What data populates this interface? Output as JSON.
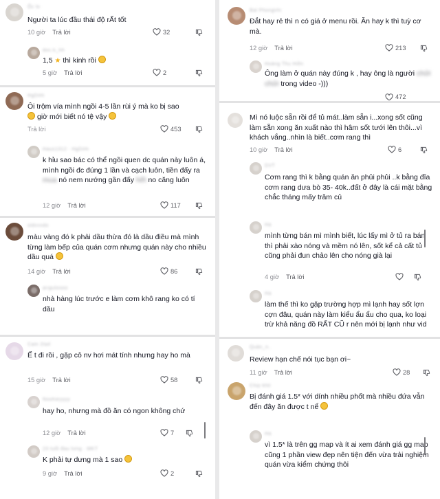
{
  "icons": {
    "like": "heart-outline-icon",
    "dislike": "thumbs-down-icon",
    "emoji": "emoji-face-icon"
  },
  "colors": {
    "text": "#161823",
    "meta": "#8a8b91",
    "divider": "#e9e9ea",
    "emoji": "#f5c33b"
  },
  "reply_label": "Trả lời",
  "left": [
    {
      "username": "Ốc lo",
      "text": "Người ta lúc đầu thái độ rẤt tốt",
      "time": "10 giờ",
      "likes": "32"
    },
    {
      "username": "doc.ti_hh",
      "text_pre": "1,5",
      "text_post": "thì kinh rồi",
      "time": "5 giờ",
      "likes": "2",
      "emoji": true
    },
    {
      "username": "HgDiHi",
      "text": "Ôi trộm vía mình ngồi 4-5 lần rùi ý mà ko bị sao",
      "text2": "giờ mới biết nó tệ vậy",
      "time": "Trả lời",
      "likes": "453"
    },
    {
      "username": "Haus1312 · HgDiHi",
      "text": "k hỉu sao bác có thể ngồi quen dc quán này luôn á, mình ngồi đc đúng 1 lần và cạch luôn, tiền đấy ra",
      "text_blur1": "mua",
      "text_mid": "nó nem nướng gần đấy",
      "text_blur2": "hết",
      "text_end": "no căng luôn",
      "time": "12 giờ",
      "likes": "117"
    },
    {
      "username": "oldvvvdo",
      "text": "màu vàng đó k phải dầu thừa đó là dầu điều mà mình từng làm bếp của quán cơm nhưng quán này cho nhiều dầu quá",
      "time": "14 giờ",
      "likes": "86"
    },
    {
      "username": "ariguloooo",
      "text": "nhà hàng lúc trước e làm cơm khô rang ko có tí dầu",
      "time": "",
      "likes": ""
    },
    {
      "username": "Cam 2ta4",
      "text": "Ế t đi rồi , gặp cô nv hơi mát tính nhưng hay ho mà",
      "time": "15 giờ",
      "likes": "58"
    },
    {
      "username": "Noohieyyyy",
      "text": "hay ho, nhưng mà đồ ăn có ngon không chứ",
      "time": "12 giờ",
      "likes": "7"
    },
    {
      "username": "23 tuổi đau lưng · MKT",
      "text": "K phải tự dưng mà 1 sao",
      "time": "9 giờ",
      "likes": "2"
    }
  ],
  "right": [
    {
      "username": "Bal Phongnhi",
      "text": "Đắt hay rẻ thì n có giá ở menu rồi. Ăn hay k thì tuỳ cơ mà.",
      "time": "12 giờ",
      "likes": "213"
    },
    {
      "username": "Hoàng Thu Hiền",
      "text": "Ông làm ở quán này đúng k , hay ông là người",
      "text_blur": "chửi chửi",
      "text_end": "trong video -)))",
      "time": "",
      "likes": "472"
    },
    {
      "username": "",
      "text": "Mì nó luộc sẵn rồi để tủ mát..làm sẵn i...xong sốt cũng làm sẵn xong ăn xuất nào thì hâm sốt tưới lên thôi...vì khách vắng..nhìn là biết..cơm rang thì",
      "time": "10 giờ",
      "likes": "6"
    },
    {
      "username": "DVT",
      "text": "Cơm rang thì k bằng quán ăn phủi phủi ..k bằng đĩa cơm rang dưa bò 35- 40k..đất ở đây là cái mặt bằng chắc tháng mấy trăm củ",
      "time": "",
      "likes": ""
    },
    {
      "username": "Hà",
      "text": "mình từng bán mì mình biết, lúc lấy mì ở tủ ra bán thì phải xào nóng và mềm nó lên, sốt kể cả cất tủ cũng phải đun chảo lên cho nóng già lại",
      "time": "4 giờ",
      "likes": ""
    },
    {
      "username": "Hà",
      "text": "làm thế thì ko gặp trường hợp mì lạnh hay sốt lợn cợn đâu, quán này làm kiểu ẩu ẩu cho qua, ko loại trừ khả năng đồ RẤT CŨ r nên mới bị lạnh như vid",
      "time": "",
      "likes": ""
    },
    {
      "username": "Quân_n..",
      "text": "Review hạn chế nói tục bạn ơi~",
      "time": "11 giờ",
      "likes": "28"
    },
    {
      "username": "Chip khô",
      "text": "Bị đánh giá 1.5* với dính nhiều phốt mà nhiều đứa vẫn đến đây ăn được t nể",
      "time": "",
      "likes": ""
    },
    {
      "username": "Hà",
      "text": "vì 1.5* là trên gg map và ít ai xem đánh giá gg map cũng 1 phần view đẹp nên tiện đến vừa trải nghiệm quán vừa kiểm chứng thôi",
      "time": "",
      "likes": ""
    }
  ]
}
